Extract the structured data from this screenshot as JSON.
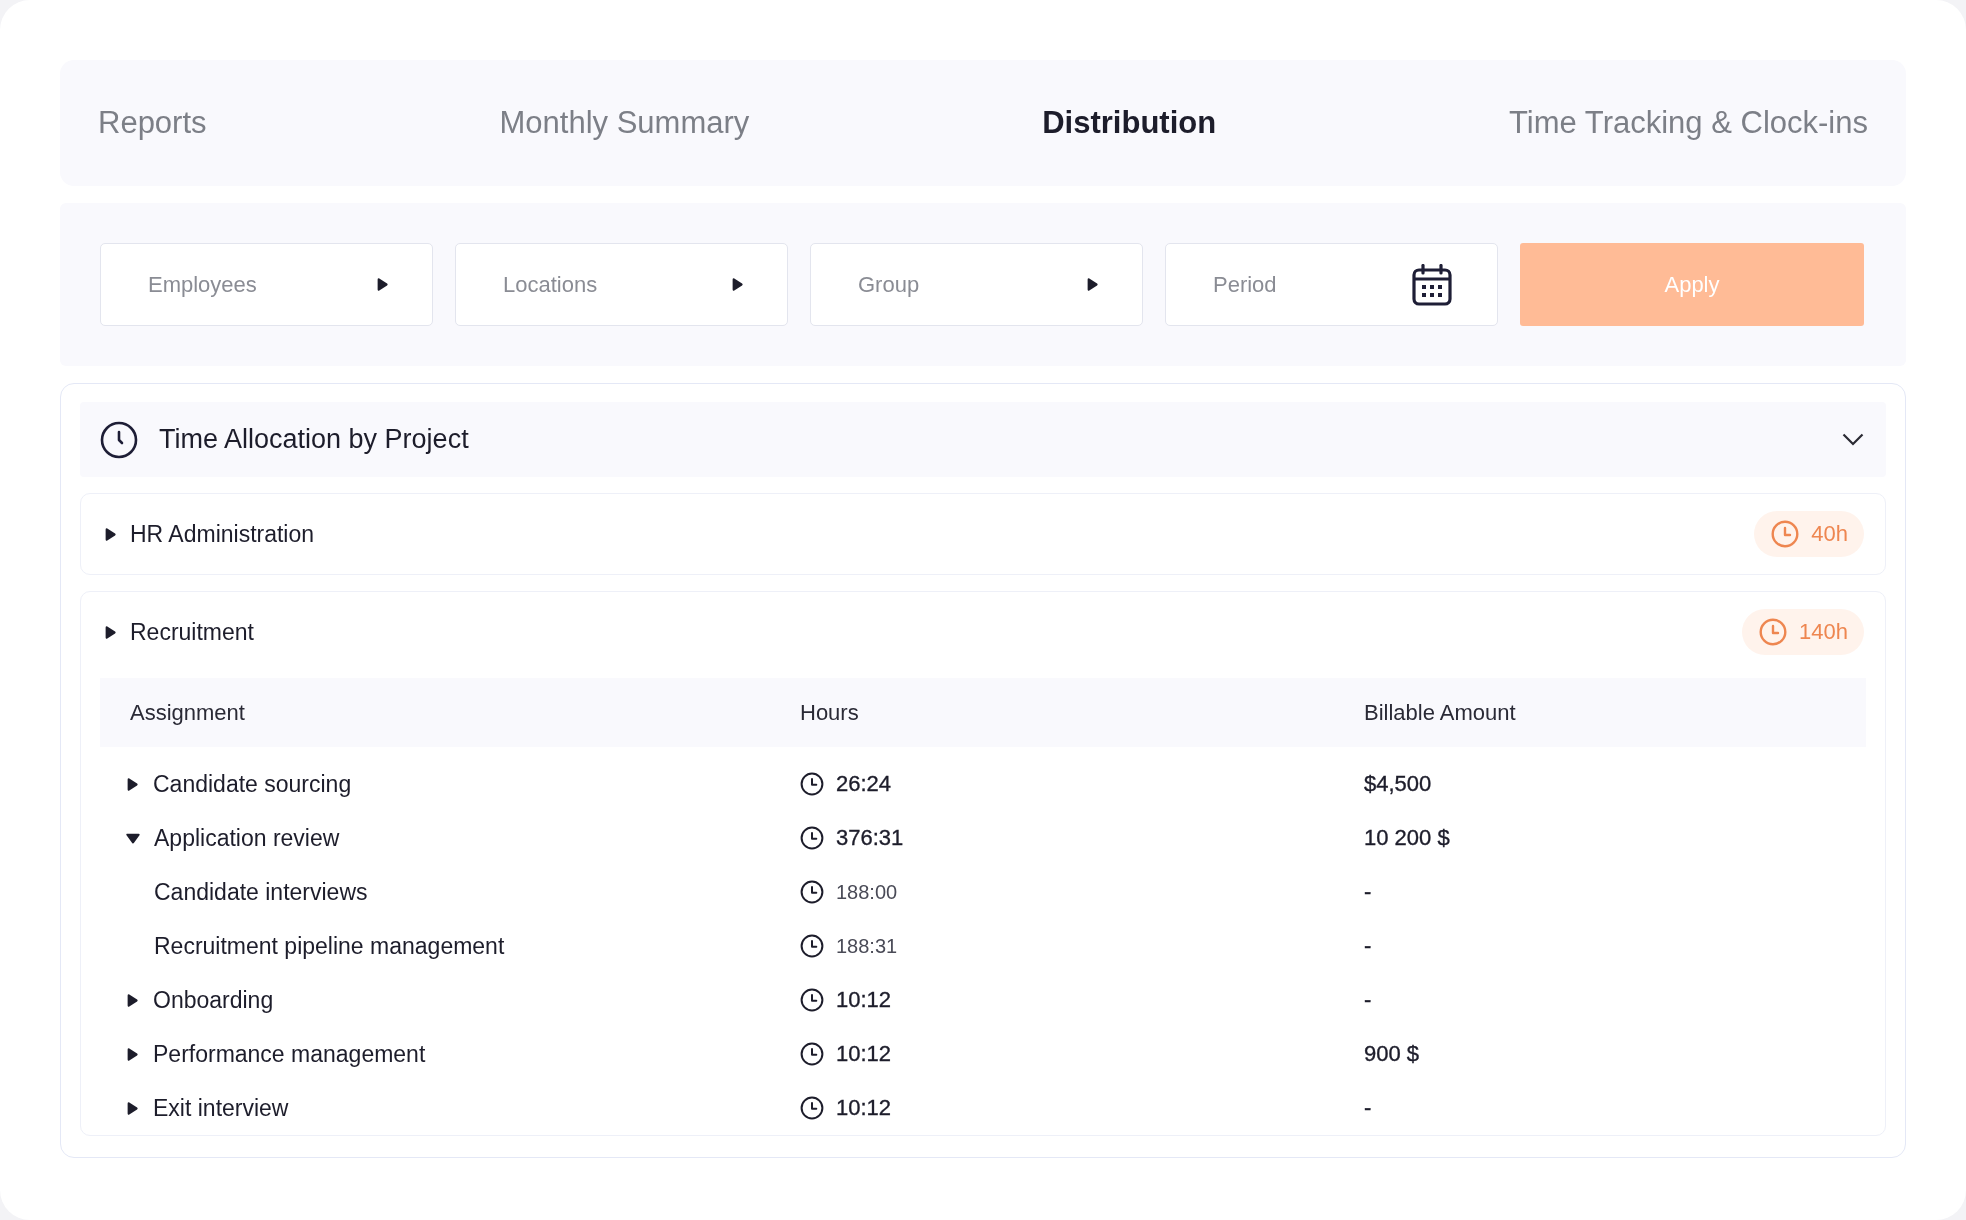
{
  "tabs": [
    {
      "label": "Reports",
      "selected": false
    },
    {
      "label": "Monthly Summary",
      "selected": false
    },
    {
      "label": "Distribution",
      "selected": true
    },
    {
      "label": "Time Tracking & Clock-ins",
      "selected": false
    }
  ],
  "filters": [
    {
      "kind": "dropdown",
      "placeholder": "Employees"
    },
    {
      "kind": "dropdown",
      "placeholder": "Locations"
    },
    {
      "kind": "dropdown",
      "placeholder": "Group"
    },
    {
      "kind": "date",
      "placeholder": "Period"
    }
  ],
  "apply_button": {
    "label": "Apply"
  },
  "section": {
    "title": "Time Allocation by Project",
    "expanded": true,
    "projects": [
      {
        "name": "HR Administration",
        "expanded": false,
        "total": "40h"
      },
      {
        "name": "Recruitment",
        "expanded": false,
        "total": "140h",
        "table": {
          "columns": [
            "Assignment",
            "Hours",
            "Billable Amount"
          ],
          "rows": [
            {
              "assignment": "Candidate sourcing",
              "expanded": false,
              "hours": "26:24",
              "billable": "$4,500"
            },
            {
              "assignment": "Application review",
              "expanded": true,
              "hours": "376:31",
              "billable": "10 200 $",
              "children": [
                {
                  "assignment": "Candidate interviews",
                  "hours": "188:00",
                  "billable": "-"
                },
                {
                  "assignment": "Recruitment pipeline management",
                  "hours": "188:31",
                  "billable": "-"
                }
              ]
            },
            {
              "assignment": "Onboarding",
              "expanded": false,
              "hours": "10:12",
              "billable": "-"
            },
            {
              "assignment": "Performance management",
              "expanded": false,
              "hours": "10:12",
              "billable": "900 $"
            },
            {
              "assignment": "Exit interview",
              "expanded": false,
              "hours": "10:12",
              "billable": "-"
            }
          ]
        }
      }
    ]
  }
}
